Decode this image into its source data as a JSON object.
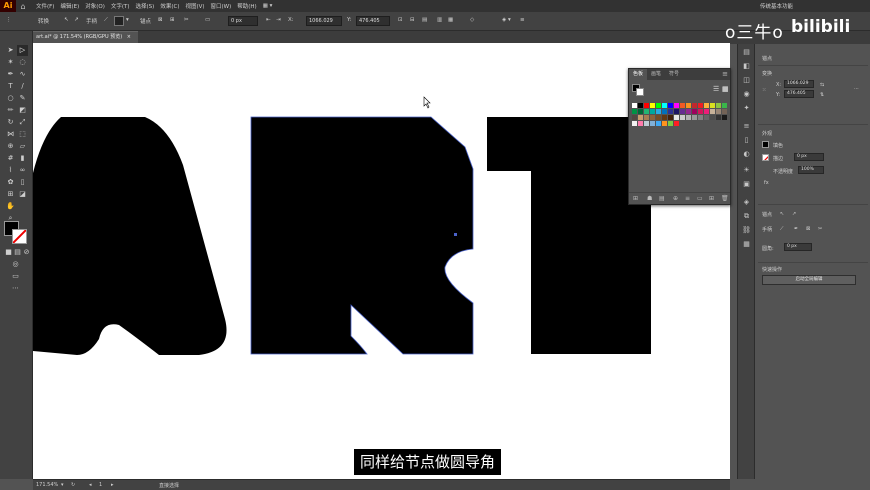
{
  "app": {
    "logo": "Ai"
  },
  "menu": [
    "文件(F)",
    "编辑(E)",
    "对象(O)",
    "文字(T)",
    "选择(S)",
    "效果(C)",
    "视图(V)",
    "窗口(W)",
    "帮助(H)"
  ],
  "workspace": "传统基本功能",
  "control": {
    "anchor": "转换",
    "handles": "手柄",
    "anchor2": "锚点",
    "stroke_value": "0 px",
    "x_value": "1066.029",
    "y_value": "476.405"
  },
  "doc_tab": "art.ai* @ 171.54% (RGB/GPU 预览)",
  "swatches": {
    "tabs": [
      "色板",
      "画笔",
      "符号"
    ]
  },
  "props": {
    "title": "锚点",
    "transform": "变换",
    "x": "1066.029",
    "y": "476.405",
    "appearance": "外观",
    "fill": "填色",
    "stroke": "描边",
    "stroke_value": "0 px",
    "opacity": "不透明度",
    "opacity_value": "100%",
    "anchor_section": "锚点",
    "corner": "圆角:",
    "corner_value": "0 px",
    "quick_actions": "快速操作",
    "quick_button": "启动全局编辑"
  },
  "status": {
    "zoom": "171.54%",
    "page": "1",
    "tool": "直接选择"
  },
  "subtitle": "同样给节点做圆导角",
  "watermark": {
    "handle": "o三牛o",
    "site": "bilibili"
  },
  "colors": {
    "selection": "#4a62c9",
    "app_bg": "#535353",
    "canvas": "#ffffff"
  }
}
